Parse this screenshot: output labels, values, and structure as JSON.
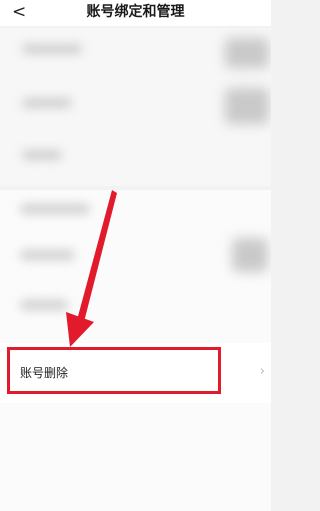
{
  "header": {
    "back_icon": "chevron-left-icon",
    "back_glyph": "<",
    "title": "账号绑定和管理"
  },
  "delete_account": {
    "label": "账号删除",
    "chevron": "›"
  },
  "annotation": {
    "color": "#e11b2b"
  }
}
